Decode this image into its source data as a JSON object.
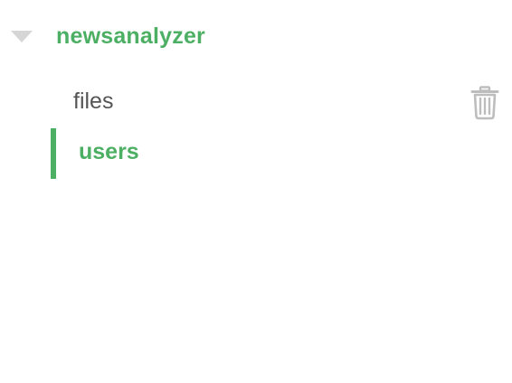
{
  "database": {
    "name": "newsanalyzer",
    "expanded": true,
    "caret_icon": "caret-down-icon"
  },
  "collections": [
    {
      "label": "files",
      "selected": false,
      "action_icon": "trash-icon"
    },
    {
      "label": "users",
      "selected": true
    }
  ],
  "colors": {
    "accent": "#4caf63",
    "text": "#555555",
    "muted_icon": "#bdbdbd"
  }
}
